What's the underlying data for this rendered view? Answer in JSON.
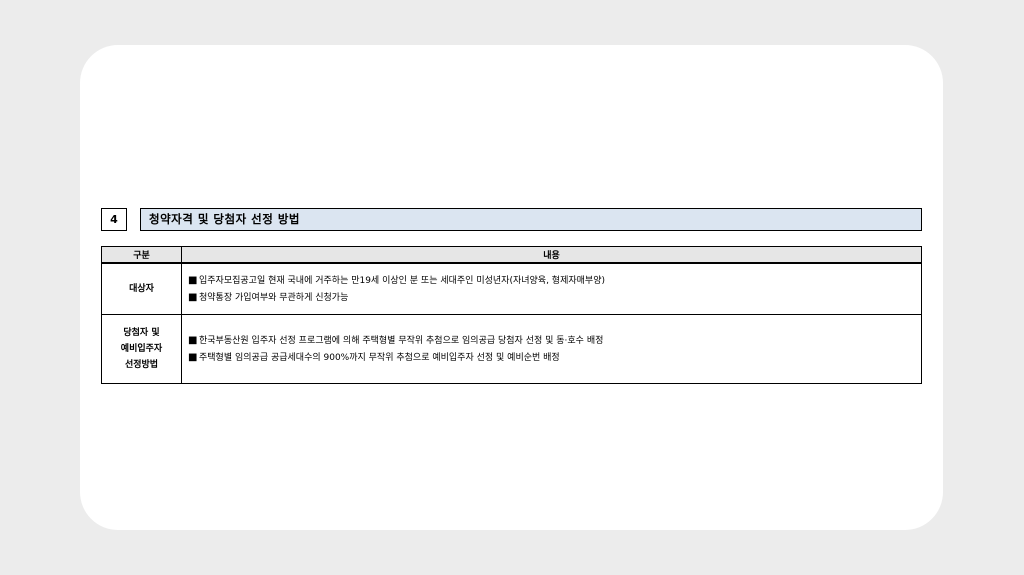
{
  "section": {
    "number": "4",
    "title": "청약자격 및 당첨자 선정 방법"
  },
  "table": {
    "headers": [
      "구분",
      "내용"
    ],
    "rows": [
      {
        "label_lines": [
          "대상자"
        ],
        "bullets": [
          "입주자모집공고일 현재 국내에 거주하는 만19세 이상인 분 또는 세대주인 미성년자(자녀양육, 형제자매부양)",
          "청약통장 가입여부와 무관하게 신청가능"
        ]
      },
      {
        "label_lines": [
          "당첨자 및",
          "예비입주자",
          "선정방법"
        ],
        "bullets": [
          "한국부동산원 입주자 선정 프로그램에 의해 주택형별 무작위 추첨으로 임의공급 당첨자 선정 및 동·호수 배정",
          "주택형별 임의공급 공급세대수의 900%까지 무작위 추첨으로 예비입주자 선정 및 예비순번 배정"
        ]
      }
    ],
    "bullet_symbol": "■"
  }
}
